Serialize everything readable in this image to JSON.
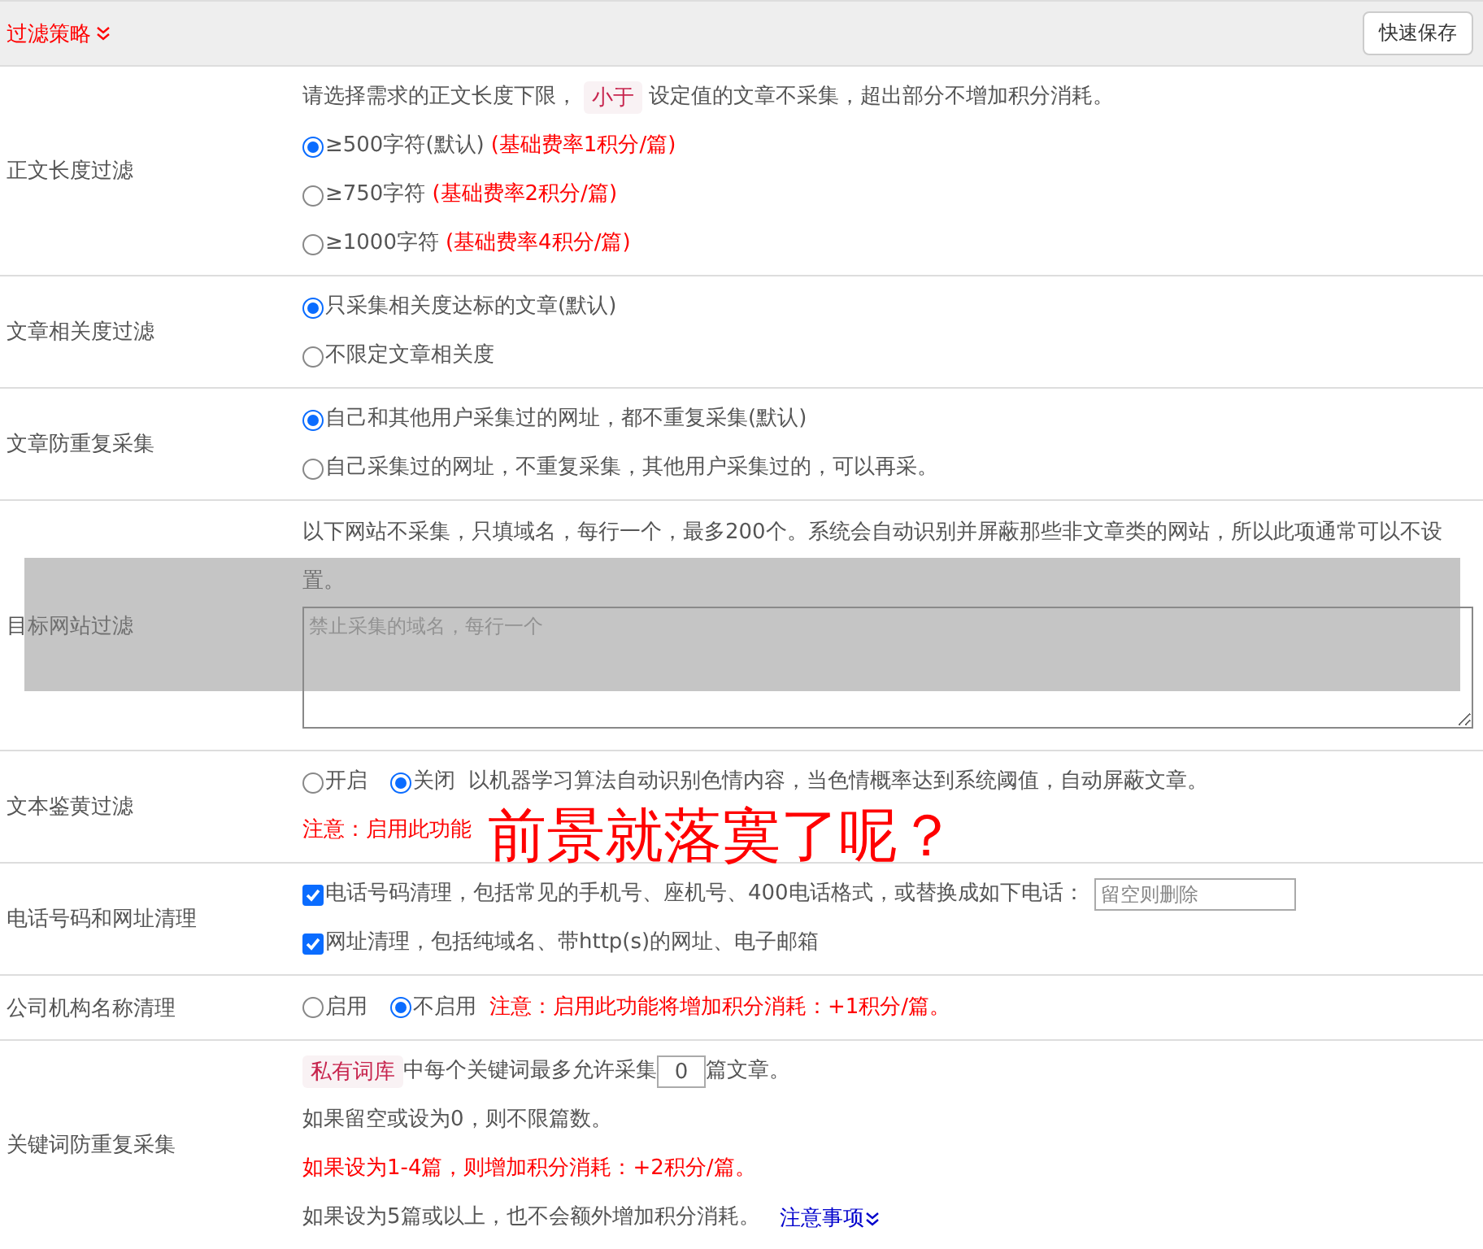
{
  "header": {
    "title": "过滤策略",
    "button": "快速保存"
  },
  "rows": [
    {
      "kind": "radios",
      "label": "正文长度过滤",
      "intro": {
        "before": "请选择需求的正文长度下限，",
        "tag": "小于",
        "after": "设定值的文章不采集，超出部分不增加积分消耗。"
      },
      "options": [
        {
          "label": "≥500字符(默认)",
          "note": "(基础费率1积分/篇)",
          "selected": true
        },
        {
          "label": "≥750字符",
          "note": "(基础费率2积分/篇)",
          "selected": false
        },
        {
          "label": "≥1000字符",
          "note": "(基础费率4积分/篇)",
          "selected": false
        }
      ]
    },
    {
      "kind": "radios",
      "label": "文章相关度过滤",
      "options": [
        {
          "label": "只采集相关度达标的文章(默认)",
          "selected": true
        },
        {
          "label": "不限定文章相关度",
          "selected": false
        }
      ]
    },
    {
      "kind": "radios",
      "label": "文章防重复采集",
      "options": [
        {
          "label": "自己和其他用户采集过的网址，都不重复采集(默认)",
          "selected": true
        },
        {
          "label": "自己采集过的网址，不重复采集，其他用户采集过的，可以再采。",
          "selected": false
        }
      ]
    },
    {
      "kind": "textarea",
      "label": "目标网站过滤",
      "intro_text": "以下网站不采集，只填域名，每行一个，最多200个。系统会自动识别并屏蔽那些非文章类的网站，所以此项通常可以不设置。",
      "placeholder": "禁止采集的域名，每行一个"
    },
    {
      "kind": "inline_radios",
      "label": "文本鉴黄过滤",
      "options": [
        {
          "label": "开启",
          "selected": false
        },
        {
          "label": "关闭",
          "selected": true
        }
      ],
      "description": "以机器学习算法自动识别色情内容，当色情概率达到系统阈值，自动屏蔽文章。",
      "note": "注意：启用此功能",
      "caption": "前景就落寞了呢？"
    },
    {
      "kind": "checks",
      "label": "电话号码和网址清理",
      "options": [
        {
          "label": "电话号码清理，包括常见的手机号、座机号、400电话格式，或替换成如下电话：",
          "checked": true,
          "placeholder": "留空则删除"
        },
        {
          "label": "网址清理，包括纯域名、带http(s)的网址、电子邮箱",
          "checked": true
        }
      ]
    },
    {
      "kind": "inline_radios",
      "label": "公司机构名称清理",
      "options": [
        {
          "label": "启用",
          "selected": false
        },
        {
          "label": "不启用",
          "selected": true
        }
      ],
      "note": "注意：启用此功能将增加积分消耗：+1积分/篇。"
    },
    {
      "kind": "keyword",
      "label": "关键词防重复采集",
      "tag": "私有词库",
      "before_input": "中每个关键词最多允许采集",
      "value": "0",
      "after_input": "篇文章。",
      "lines": [
        {
          "kind": "plain",
          "text": "如果留空或设为0，则不限篇数。"
        },
        {
          "kind": "warning",
          "text": "如果设为1-4篇，则增加积分消耗：+2积分/篇。"
        },
        {
          "kind": "plain",
          "text": "如果设为5篇或以上，也不会额外增加积分消耗。",
          "link": "注意事项"
        }
      ]
    }
  ]
}
